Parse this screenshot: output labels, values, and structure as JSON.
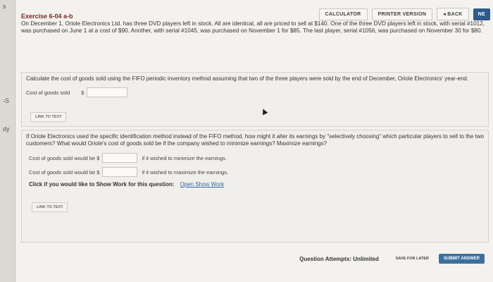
{
  "topbar": {
    "calculator": "CALCULATOR",
    "printer": "PRINTER VERSION",
    "back": "◂ BACK",
    "next": "NE"
  },
  "exercise": {
    "title": "Exercise 6-04 a-b",
    "intro": "On December 1, Oriole Electronics Ltd. has three DVD players left in stock. All are identical, all are priced to sell at $140. One of the three DVD players left in stock, with serial #1012, was purchased on June 1 at a cost of $90. Another, with serial #1045, was purchased on November 1 for $85. The last player, serial #1056, was purchased on November 30 for $80."
  },
  "part_a": {
    "question": "Calculate the cost of goods sold using the FIFO periodic inventory method assuming that two of the three players were sold by the end of December, Oriole Electronics' year-end.",
    "cogs_label": "Cost of goods sold",
    "currency": "$",
    "cogs_value": "",
    "link": "LINK TO TEXT"
  },
  "part_b": {
    "question": "If Oriole Electronics used the specific identification method instead of the FIFO method, how might it alter its earnings by \"selectively choosing\" which particular players to sell to the two customers? What would Oriole's cost of goods sold be if the company wished to minimize earnings? Maximize earnings?",
    "row1_label": "Cost of goods sold would be $",
    "row1_value": "",
    "row1_suffix": "if it wished to minimize the earnings.",
    "row2_label": "Cost of goods sold would be $",
    "row2_value": "",
    "row2_suffix": "if it wished to maximize the earnings.",
    "show_work_prompt": "Click if you would like to Show Work for this question:",
    "show_work_link": "Open Show Work",
    "link": "LINK TO TEXT"
  },
  "footer": {
    "attempts": "Question Attempts: Unlimited",
    "save": "SAVE FOR LATER",
    "submit": "SUBMIT ANSWER"
  },
  "sidebar": {
    "glyph_top": "s",
    "glyph_mid": "-S",
    "glyph_low": "dy"
  }
}
